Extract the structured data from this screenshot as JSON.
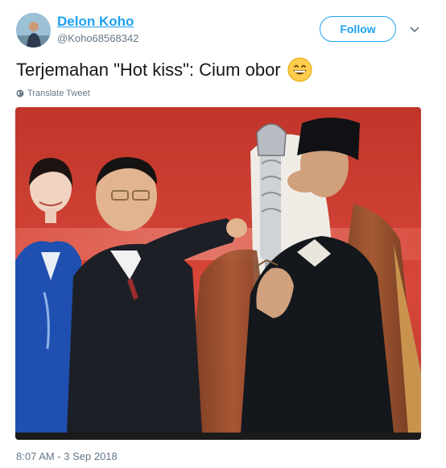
{
  "user": {
    "display_name": "Delon Koho",
    "handle": "@Koho68568342",
    "avatar_icon": "user-avatar-photo"
  },
  "actions": {
    "follow_label": "Follow",
    "menu_icon": "chevron-down-icon"
  },
  "tweet": {
    "text": "Terjemahan \"Hot kiss\": Cium obor",
    "emoji": "grinning-face-with-smiling-eyes",
    "translate_label": "Translate Tweet",
    "translate_icon": "globe-icon",
    "timestamp": "8:07 AM - 3 Sep 2018"
  },
  "colors": {
    "accent": "#1da1f2",
    "secondary_text": "#657786",
    "primary_text": "#14171a"
  }
}
